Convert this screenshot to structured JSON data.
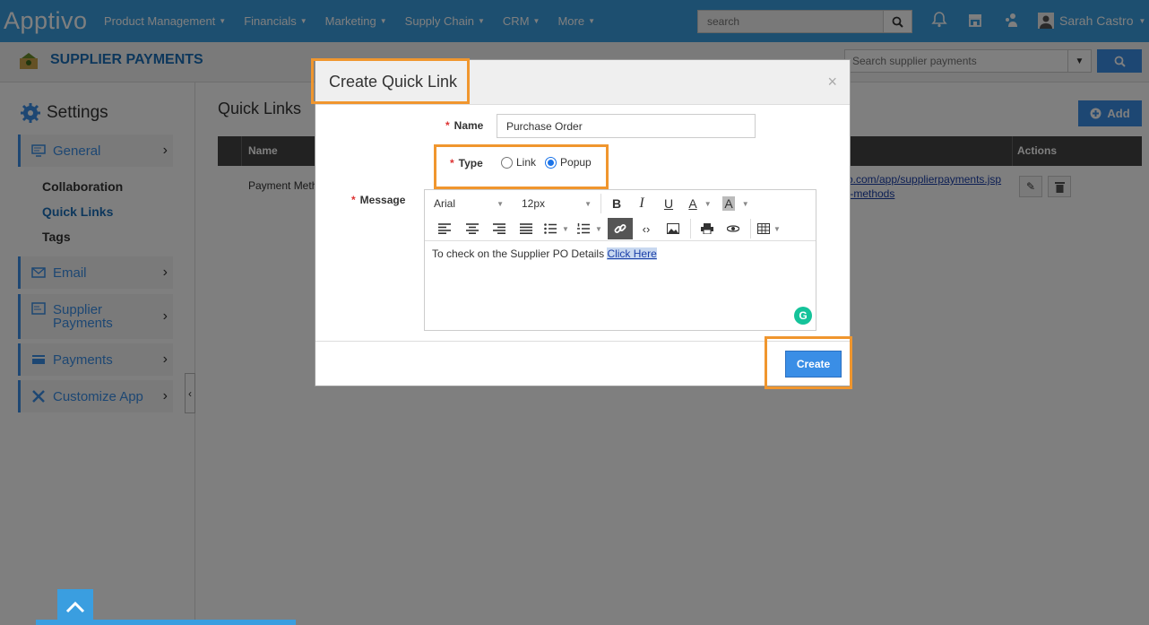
{
  "topbar": {
    "logo": "Apptivo",
    "nav": [
      {
        "label": "Product Management"
      },
      {
        "label": "Financials"
      },
      {
        "label": "Marketing"
      },
      {
        "label": "Supply Chain"
      },
      {
        "label": "CRM"
      },
      {
        "label": "More"
      }
    ],
    "search_placeholder": "search",
    "user_name": "Sarah Castro"
  },
  "subheader": {
    "app_title": "SUPPLIER PAYMENTS",
    "search_placeholder": "Search supplier payments"
  },
  "sidebar": {
    "heading": "Settings",
    "items": [
      {
        "label": "General"
      },
      {
        "label": "Email"
      },
      {
        "label": "Supplier Payments"
      },
      {
        "label": "Payments"
      },
      {
        "label": "Customize App"
      }
    ],
    "sub_links": [
      "Collaboration",
      "Quick Links",
      "Tags"
    ]
  },
  "main": {
    "title": "Quick Links",
    "add_label": "Add",
    "columns": [
      "Name",
      "Actions"
    ],
    "row": {
      "name": "Payment Meth",
      "url_line1": "o.com/app/supplierpayments.jsp",
      "url_line2": "t-methods"
    }
  },
  "modal": {
    "title": "Create Quick Link",
    "name_label": "Name",
    "name_value": "Purchase Order",
    "type_label": "Type",
    "type_options": [
      "Link",
      "Popup"
    ],
    "type_selected": "Popup",
    "message_label": "Message",
    "font_family": "Arial",
    "font_size": "12px",
    "message_text": "To check on the Supplier PO Details ",
    "message_link": "Click Here",
    "create_label": "Create",
    "close_label": "×"
  },
  "colors": {
    "primary": "#3a9ee0",
    "button": "#3a8ee6",
    "highlight": "#f0962e"
  }
}
